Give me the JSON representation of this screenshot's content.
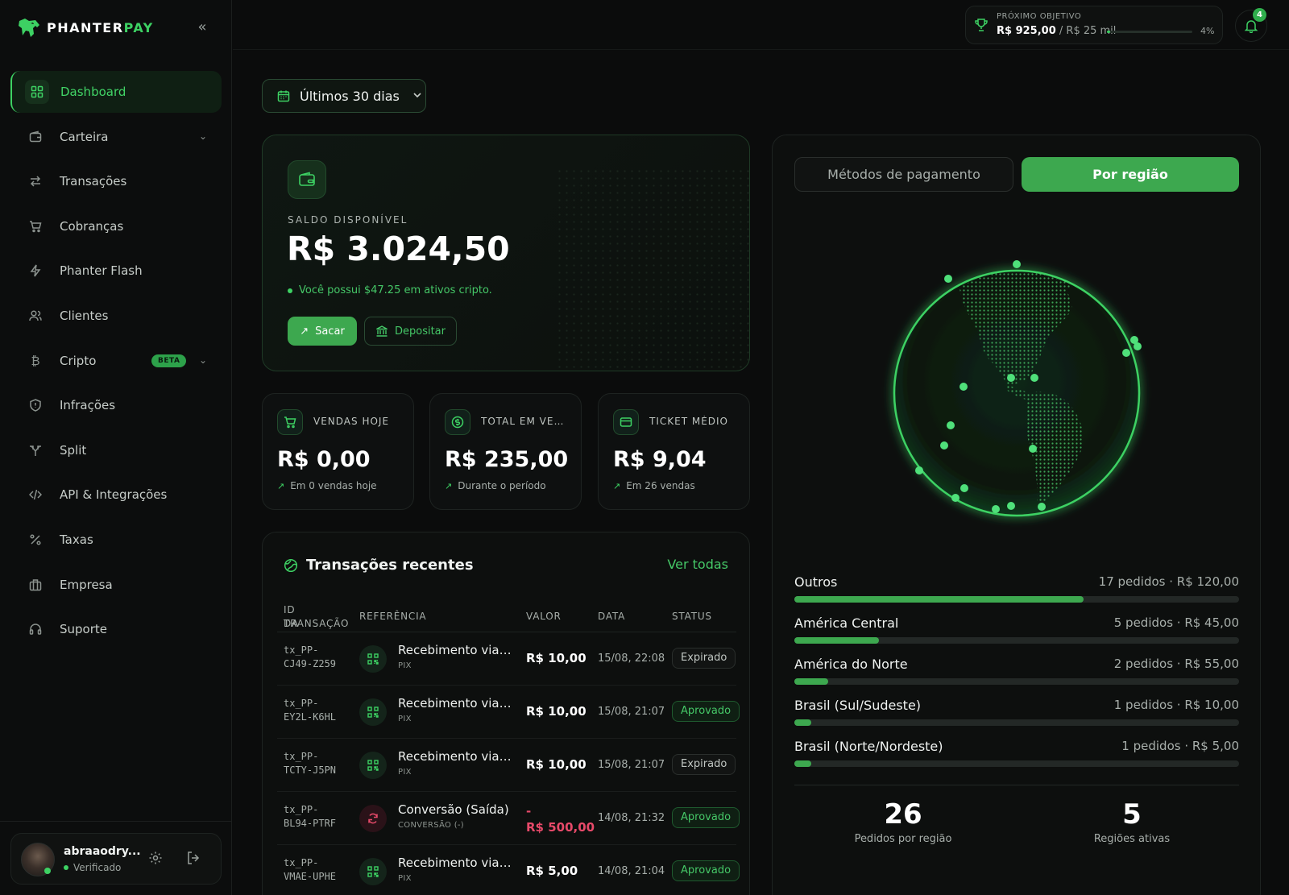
{
  "brand": {
    "name_part1": "PHANTER",
    "name_part2": "PAY"
  },
  "sidebar": {
    "collapse_icon": "chevrons-left-icon",
    "items": [
      {
        "label": "Dashboard",
        "icon": "grid-icon",
        "active": true
      },
      {
        "label": "Carteira",
        "icon": "wallet-icon",
        "has_chevron": true
      },
      {
        "label": "Transações",
        "icon": "arrows-left-right-icon"
      },
      {
        "label": "Cobranças",
        "icon": "cart-icon"
      },
      {
        "label": "Phanter Flash",
        "icon": "lightning-icon"
      },
      {
        "label": "Clientes",
        "icon": "users-icon"
      },
      {
        "label": "Cripto",
        "icon": "bitcoin-icon",
        "badge": "BETA",
        "has_chevron": true
      },
      {
        "label": "Infrações",
        "icon": "shield-icon"
      },
      {
        "label": "Split",
        "icon": "split-icon"
      },
      {
        "label": "API & Integrações",
        "icon": "code-icon"
      },
      {
        "label": "Taxas",
        "icon": "percent-icon"
      },
      {
        "label": "Empresa",
        "icon": "building-icon"
      },
      {
        "label": "Suporte",
        "icon": "headset-icon"
      }
    ],
    "user": {
      "name": "abraaodry...",
      "status": "Verificado"
    }
  },
  "topbar": {
    "goal": {
      "label": "PRÓXIMO OBJETIVO",
      "current": "R$ 925,00",
      "separator": " / ",
      "target": "R$ 25 mil",
      "percent_text": "4%",
      "progress": 0.04
    },
    "notifications_count": "4"
  },
  "filter": {
    "date_range": "Últimos 30 dias"
  },
  "balance": {
    "label": "SALDO DISPONÍVEL",
    "value": "R$ 3.024,50",
    "crypto_note": "Você possui $47.25 em ativos cripto.",
    "withdraw_label": "Sacar",
    "deposit_label": "Depositar"
  },
  "stats": [
    {
      "label": "VENDAS HOJE",
      "value": "R$ 0,00",
      "sub": "Em 0 vendas hoje",
      "icon": "cart-icon"
    },
    {
      "label": "TOTAL EM VENDAS",
      "value": "R$ 235,00",
      "sub": "Durante o período",
      "icon": "dollar-circle-icon"
    },
    {
      "label": "TICKET MÉDIO",
      "value": "R$ 9,04",
      "sub": "Em 26 vendas",
      "icon": "card-icon"
    }
  ],
  "transactions": {
    "title": "Transações recentes",
    "view_all": "Ver todas",
    "columns": {
      "id_line1": "ID DA",
      "id_line2": "TRANSAÇÃO",
      "ref": "REFERÊNCIA",
      "value": "VALOR",
      "date": "DATA",
      "status": "STATUS"
    },
    "rows": [
      {
        "id1": "tx_PP-",
        "id2": "CJ49-Z259",
        "ref": "Recebimento via PIX",
        "type": "PIX",
        "value": "R$ 10,00",
        "value2": "",
        "date": "15/08, 22:08",
        "status": "Expirado",
        "status_kind": "expired",
        "kind": "pix"
      },
      {
        "id1": "tx_PP-",
        "id2": "EY2L-K6HL",
        "ref": "Recebimento via PIX",
        "type": "PIX",
        "value": "R$ 10,00",
        "value2": "",
        "date": "15/08, 21:07",
        "status": "Aprovado",
        "status_kind": "approved",
        "kind": "pix"
      },
      {
        "id1": "tx_PP-",
        "id2": "TCTY-J5PN",
        "ref": "Recebimento via PIX",
        "type": "PIX",
        "value": "R$ 10,00",
        "value2": "",
        "date": "15/08, 21:07",
        "status": "Expirado",
        "status_kind": "expired",
        "kind": "pix"
      },
      {
        "id1": "tx_PP-",
        "id2": "BL94-PTRF",
        "ref": "Conversão (Saída)",
        "type": "CONVERSÃO (-)",
        "value": "-",
        "value2": "R$ 500,00",
        "date": "14/08, 21:32",
        "status": "Aprovado",
        "status_kind": "approved",
        "kind": "conv"
      },
      {
        "id1": "tx_PP-",
        "id2": "VMAE-UPHE",
        "ref": "Recebimento via PIX",
        "type": "PIX",
        "value": "R$ 5,00",
        "value2": "",
        "date": "14/08, 21:04",
        "status": "Aprovado",
        "status_kind": "approved",
        "kind": "pix"
      }
    ]
  },
  "regions": {
    "tab_methods": "Métodos de pagamento",
    "tab_region": "Por região",
    "items": [
      {
        "name": "Outros",
        "stats": "17 pedidos · R$ 120,00",
        "share": 0.65
      },
      {
        "name": "América Central",
        "stats": "5 pedidos · R$ 45,00",
        "share": 0.19
      },
      {
        "name": "América do Norte",
        "stats": "2 pedidos · R$ 55,00",
        "share": 0.076
      },
      {
        "name": "Brasil (Sul/Sudeste)",
        "stats": "1 pedidos · R$ 10,00",
        "share": 0.038
      },
      {
        "name": "Brasil (Norte/Nordeste)",
        "stats": "1 pedidos · R$ 5,00",
        "share": 0.038
      }
    ],
    "summary": [
      {
        "value": "26",
        "label": "Pedidos por região"
      },
      {
        "value": "5",
        "label": "Regiões ativas"
      }
    ]
  },
  "colors": {
    "accent": "#3dd163",
    "accent_dark": "#3da84f",
    "background": "#0b0c0c",
    "negative": "#e84a6a"
  }
}
